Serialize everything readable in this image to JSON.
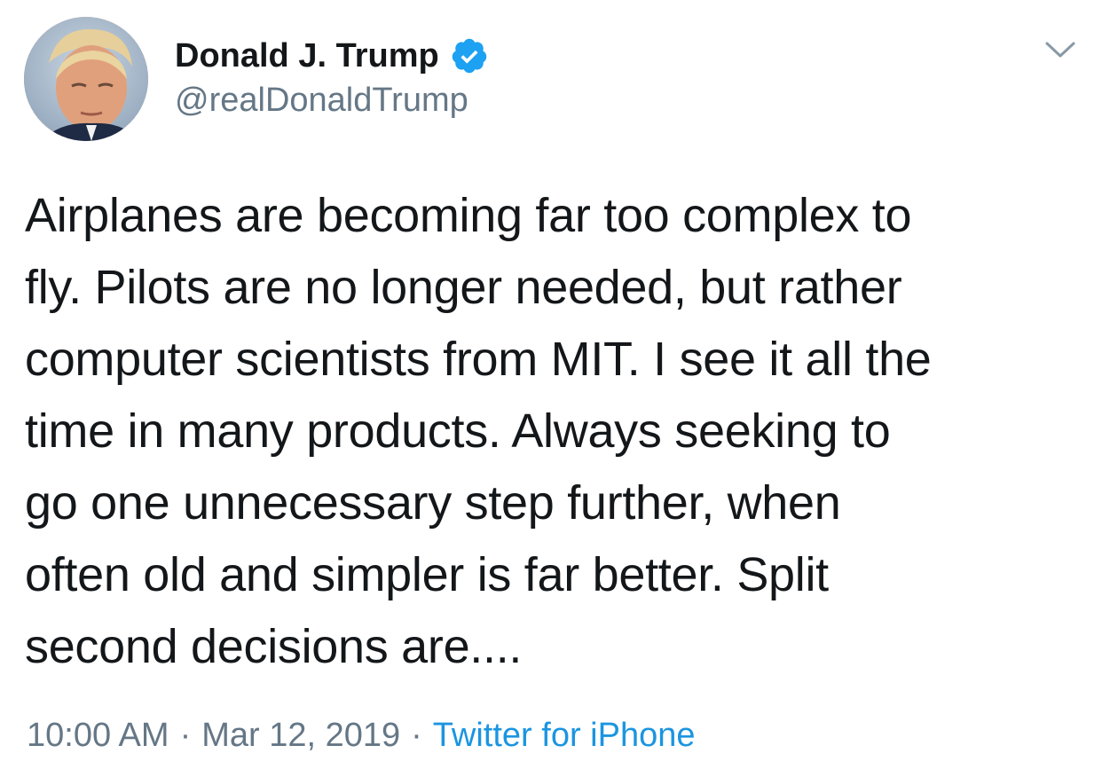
{
  "author": {
    "display_name": "Donald J. Trump",
    "handle": "@realDonaldTrump",
    "verified": true,
    "verified_color": "#1da1f2"
  },
  "header": {
    "menu_icon": "chevron-down-icon"
  },
  "tweet": {
    "lines": [
      "Airplanes are becoming far too complex to",
      "fly. Pilots are no longer needed, but rather",
      "computer scientists from MIT. I see it all the",
      "time in many products. Always seeking to",
      "go one unnecessary step further, when",
      "often old and simpler is far better. Split",
      "second decisions are...."
    ]
  },
  "meta": {
    "time": "10:00 AM",
    "separator": "·",
    "date": "Mar 12, 2019",
    "source": "Twitter for iPhone",
    "source_color": "#1b95e0",
    "secondary_color": "#657786"
  }
}
